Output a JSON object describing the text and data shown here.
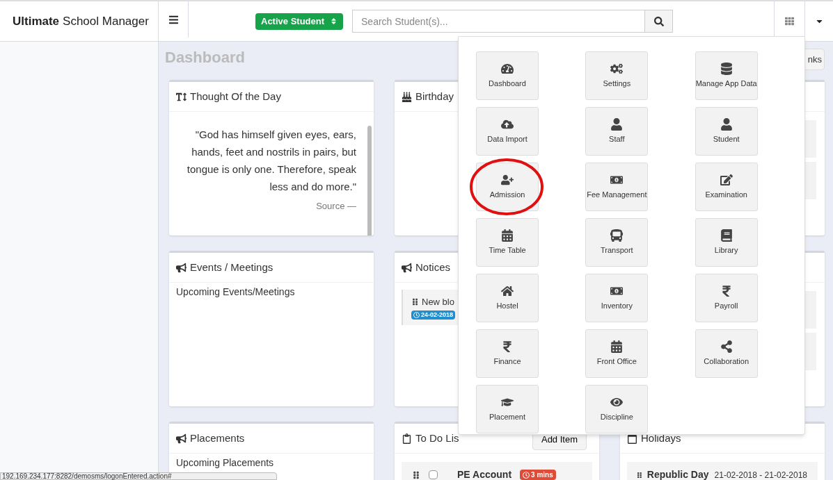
{
  "header": {
    "logo_bold": "Ultimate",
    "logo_rest": "School Manager",
    "status_select": "Active Student",
    "search": {
      "placeholder": "Search Student(s)..."
    }
  },
  "page_title": "Dashboard",
  "links_button": "nks",
  "cards": [
    {
      "kind": "quote",
      "title": "Thought Of the Day",
      "quote": "\"God has himself given eyes, ears, hands, feet and nostrils in pairs, but tongue is only one. Therefore, speak less and do more.\"",
      "source": "Source —"
    },
    {
      "kind": "empty",
      "title": "Birthday"
    },
    {
      "kind": "blank"
    },
    {
      "kind": "text",
      "title": "Events / Meetings",
      "text": "Upcoming Events/Meetings"
    },
    {
      "kind": "notices",
      "title": "Notices",
      "item": "New blo",
      "date": "24-02-2018"
    },
    {
      "kind": "blank"
    },
    {
      "kind": "text",
      "title": "Placements",
      "text": "Upcoming Placements"
    },
    {
      "kind": "todo",
      "title": "To Do Lis",
      "button": "Add Item",
      "item": "PE Account",
      "checked": false,
      "badge": "3 mins"
    },
    {
      "kind": "holidays",
      "title": "Holidays",
      "name": "Republic Day",
      "dates": "21-02-2018 - 21-02-2018"
    }
  ],
  "menu": [
    {
      "label": "Dashboard",
      "highlighted": false
    },
    {
      "label": "Settings",
      "highlighted": false
    },
    {
      "label": "Manage App Data",
      "highlighted": false
    },
    {
      "label": "Data Import",
      "highlighted": false
    },
    {
      "label": "Staff",
      "highlighted": false
    },
    {
      "label": "Student",
      "highlighted": false
    },
    {
      "label": "Admission",
      "highlighted": true
    },
    {
      "label": "Fee Management",
      "highlighted": false
    },
    {
      "label": "Examination",
      "highlighted": false
    },
    {
      "label": "Time Table",
      "highlighted": false
    },
    {
      "label": "Transport",
      "highlighted": false
    },
    {
      "label": "Library",
      "highlighted": false
    },
    {
      "label": "Hostel",
      "highlighted": false
    },
    {
      "label": "Inventory",
      "highlighted": false
    },
    {
      "label": "Payroll",
      "highlighted": false
    },
    {
      "label": "Finance",
      "highlighted": false
    },
    {
      "label": "Front Office",
      "highlighted": false
    },
    {
      "label": "Collaboration",
      "highlighted": false
    },
    {
      "label": "Placement",
      "highlighted": false
    },
    {
      "label": "Discipline",
      "highlighted": false
    }
  ],
  "status_bar": "192.169.234.177:8282/demosms/logonEntered.action#"
}
